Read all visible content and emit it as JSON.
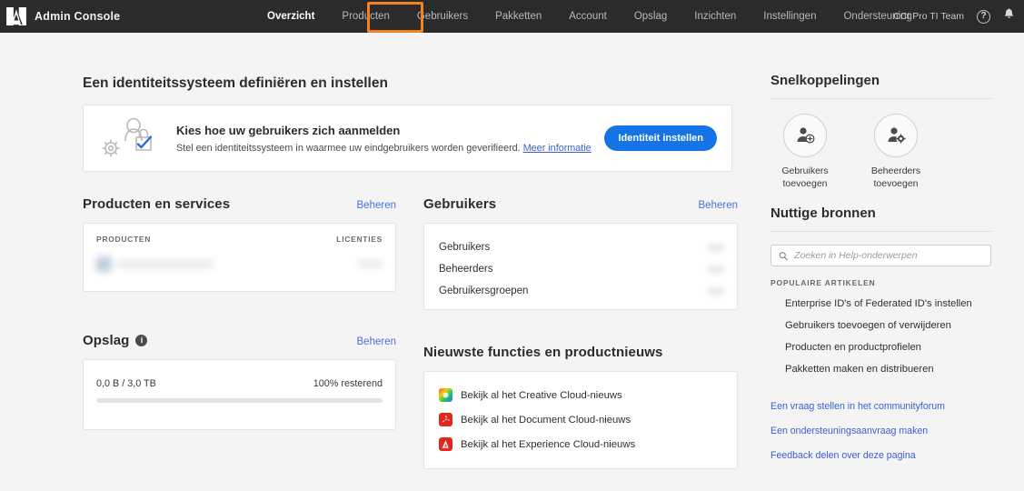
{
  "topbar": {
    "logo_icon": "adobe-logo-icon",
    "brand": "Admin Console",
    "nav": [
      {
        "label": "Overzicht",
        "active": true
      },
      {
        "label": "Producten",
        "active": false
      },
      {
        "label": "Gebruikers",
        "active": false,
        "highlighted": true
      },
      {
        "label": "Pakketten",
        "active": false
      },
      {
        "label": "Account",
        "active": false
      },
      {
        "label": "Opslag",
        "active": false
      },
      {
        "label": "Inzichten",
        "active": false
      },
      {
        "label": "Instellingen",
        "active": false
      },
      {
        "label": "Ondersteuning",
        "active": false
      }
    ],
    "team": "CCI Pro TI Team",
    "help_icon": "help-icon",
    "help_glyph": "?",
    "bell_icon": "notification-bell-icon",
    "highlight_color": "#f58220"
  },
  "identity": {
    "section_title": "Een identiteitssysteem definiëren en instellen",
    "heading": "Kies hoe uw gebruikers zich aanmelden",
    "description": "Stel een identiteitssysteem in waarmee uw eindgebruikers worden geverifieerd.",
    "link": "Meer informatie",
    "button": "Identiteit instellen",
    "button_color": "#1473e6",
    "illustration_icon": "identity-gear-lock-icon"
  },
  "products": {
    "title": "Producten en services",
    "manage": "Beheren",
    "columns": [
      "PRODUCTEN",
      "LICENTIES"
    ]
  },
  "storage": {
    "title": "Opslag",
    "info_icon": "info-icon",
    "info_glyph": "i",
    "manage": "Beheren",
    "used_of_total": "0,0 B / 3,0 TB",
    "remaining": "100% resterend",
    "percent_used": 0
  },
  "users": {
    "title": "Gebruikers",
    "manage": "Beheren",
    "rows": [
      {
        "label": "Gebruikers"
      },
      {
        "label": "Beheerders"
      },
      {
        "label": "Gebruikersgroepen"
      }
    ]
  },
  "news": {
    "title": "Nieuwste functies en productnieuws",
    "items": [
      {
        "label": "Bekijk al het Creative Cloud-nieuws",
        "icon": "creative-cloud-icon"
      },
      {
        "label": "Bekijk al het Document Cloud-nieuws",
        "icon": "document-cloud-icon"
      },
      {
        "label": "Bekijk al het Experience Cloud-nieuws",
        "icon": "experience-cloud-icon"
      }
    ]
  },
  "shortcuts": {
    "title": "Snelkoppelingen",
    "items": [
      {
        "label": "Gebruikers toevoegen",
        "icon": "add-user-icon"
      },
      {
        "label": "Beheerders toevoegen",
        "icon": "add-admin-icon"
      }
    ]
  },
  "resources": {
    "title": "Nuttige bronnen",
    "search_placeholder": "Zoeken in Help-onderwerpen",
    "search_value": "",
    "search_icon": "search-icon",
    "popular_heading": "POPULAIRE ARTIKELEN",
    "articles": [
      "Enterprise ID's of Federated ID's instellen",
      "Gebruikers toevoegen of verwijderen",
      "Producten en productprofielen",
      "Pakketten maken en distribueren"
    ],
    "support_links": [
      "Een vraag stellen in het communityforum",
      "Een ondersteuningsaanvraag maken",
      "Feedback delen over deze pagina"
    ],
    "link_color": "#3b5fd0"
  }
}
